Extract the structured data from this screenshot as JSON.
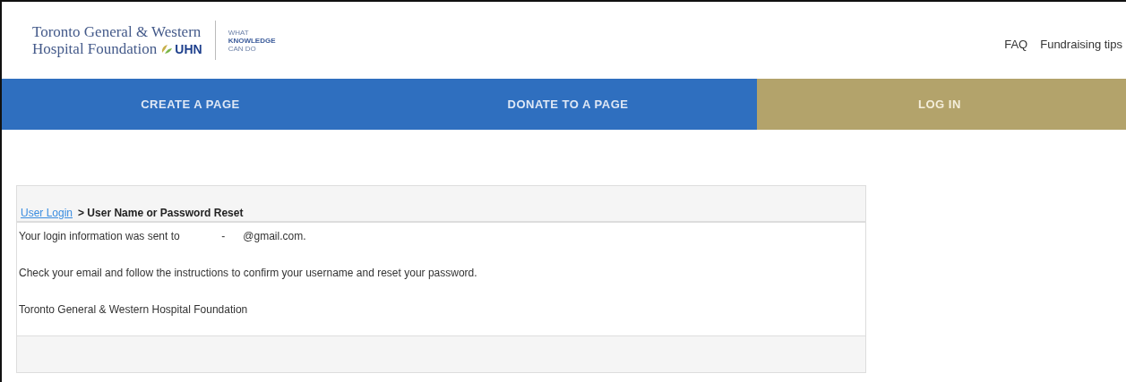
{
  "header": {
    "logo": {
      "line_1": "Toronto General & Western",
      "line_2": "Hospital Foundation",
      "mark": "UHN",
      "tagline": [
        "WHAT",
        "KNOWLEDGE",
        "CAN DO"
      ]
    },
    "links": [
      "FAQ",
      "Fundraising tips"
    ]
  },
  "nav": [
    {
      "label": "CREATE A PAGE",
      "selected": false
    },
    {
      "label": "DONATE TO A PAGE",
      "selected": false
    },
    {
      "label": "LOG IN",
      "selected": true
    }
  ],
  "card": {
    "breadcrumb": {
      "link": "User Login",
      "current": "> User Name or Password Reset"
    },
    "lines": [
      "Your login information was sent to              -      @gmail.com.",
      "Check your email and follow the instructions to confirm your username and reset your password.",
      "Toronto General & Western Hospital Foundation"
    ]
  }
}
